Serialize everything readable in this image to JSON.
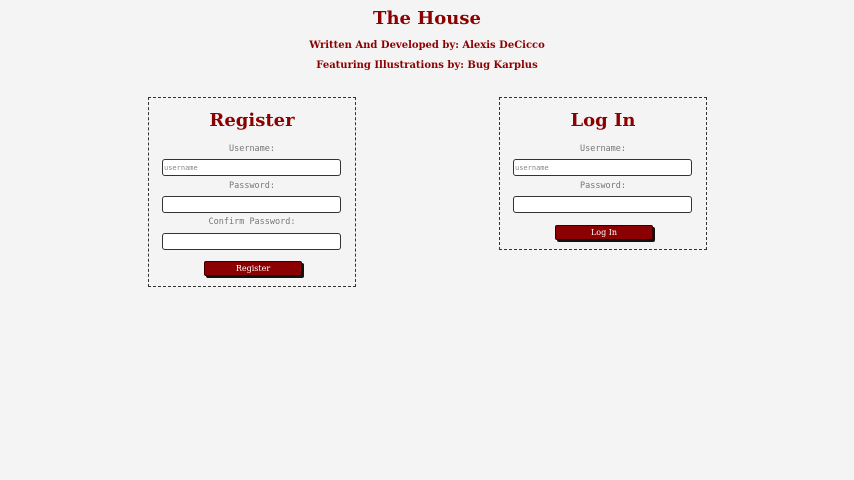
{
  "header": {
    "title": "The House",
    "author_credit": "Written And Developed by: Alexis DeCicco",
    "illustrator_credit": "Featuring Illustrations by: Bug Karplus"
  },
  "register": {
    "title": "Register",
    "username_label": "Username:",
    "username_placeholder": "username",
    "username_value": "",
    "password_label": "Password:",
    "password_value": "",
    "confirm_label": "Confirm Password:",
    "confirm_value": "",
    "button_label": "Register"
  },
  "login": {
    "title": "Log In",
    "username_label": "Username:",
    "username_placeholder": "username",
    "username_value": "",
    "password_label": "Password:",
    "password_value": "",
    "button_label": "Log In"
  },
  "colors": {
    "background": "#f4f4f4",
    "accent": "#8b0000",
    "label": "#777777"
  }
}
